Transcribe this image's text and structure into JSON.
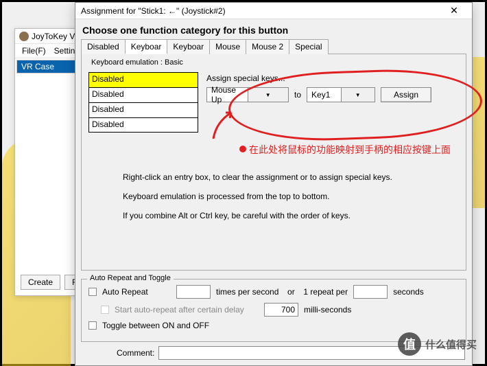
{
  "bg": {
    "title": "JoyToKey Ve",
    "menu": [
      "File(F)",
      "Settings("
    ],
    "list_item": "VR Case",
    "buttons": [
      "Create",
      "Ren"
    ]
  },
  "dialog": {
    "title": "Assignment for \"Stick1: ←\" (Joystick#2)",
    "heading": "Choose one function category for this button",
    "tabs": [
      "Disabled",
      "Keyboar",
      "Keyboar",
      "Mouse",
      "Mouse 2",
      "Special"
    ],
    "group_label": "Keyboard emulation : Basic",
    "entries": [
      "Disabled",
      "Disabled",
      "Disabled",
      "Disabled"
    ],
    "special": {
      "title": "Assign special keys...",
      "combo1": "Mouse Up",
      "to": "to",
      "combo2": "Key1",
      "assign": "Assign"
    },
    "info": [
      "Right-click an entry box, to clear the assignment or to assign special keys.",
      "Keyboard emulation is processed from the top to bottom.",
      "If you combine Alt or Ctrl key, be careful with the order of keys."
    ],
    "auto": {
      "legend": "Auto Repeat and Toggle",
      "cb1": "Auto Repeat",
      "tps": "times per second",
      "or": "or",
      "rp": "1 repeat per",
      "sec": "seconds",
      "cb2": "Start auto-repeat after certain delay",
      "delay_val": "700",
      "ms": "milli-seconds",
      "cb3": "Toggle between ON and OFF"
    },
    "comment_label": "Comment:"
  },
  "annotation": "在此处将鼠标的功能映射到手柄的相应按键上面",
  "watermark": {
    "logo": "值",
    "text": "什么值得买"
  }
}
